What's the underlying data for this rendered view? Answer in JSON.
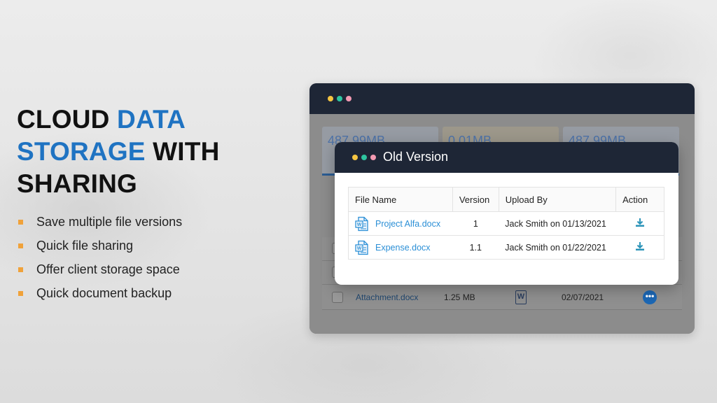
{
  "headline": {
    "part1": "CLOUD ",
    "part2": "DATA",
    "part3": "STORAGE",
    "part4": " WITH",
    "part5": "SHARING"
  },
  "bullets": [
    "Save multiple file versions",
    "Quick file sharing",
    "Offer client storage space",
    "Quick document backup"
  ],
  "background_app": {
    "stats": [
      "487.99MB",
      "0.01MB",
      "487.99MB"
    ],
    "stat_colors": [
      "#9fb5d3",
      "#c9b48a",
      "#a8bcd6"
    ],
    "visible_row": {
      "file": "Attachment.docx",
      "size": "1.25 MB",
      "date": "02/07/2021"
    }
  },
  "modal": {
    "title": "Old Version",
    "columns": [
      "File Name",
      "Version",
      "Upload By",
      "Action"
    ],
    "rows": [
      {
        "file": "Project Alfa.docx",
        "version": "1",
        "uploaded_by": "Jack Smith on 01/13/2021"
      },
      {
        "file": "Expense.docx",
        "version": "1.1",
        "uploaded_by": "Jack Smith on 01/22/2021"
      }
    ]
  },
  "colors": {
    "accent_blue": "#1f73c2",
    "bullet_orange": "#f0a23a",
    "titlebar": "#1e2636",
    "dot_yellow": "#f5c542",
    "dot_green": "#2ec4a0",
    "dot_pink": "#f39ab2",
    "link_blue": "#2b8fd6",
    "download_teal": "#2a93b8"
  },
  "icons": {
    "window_dots": "traffic-light-dots",
    "file": "word-doc-icon",
    "download": "download-icon",
    "more": "more-options-icon"
  }
}
